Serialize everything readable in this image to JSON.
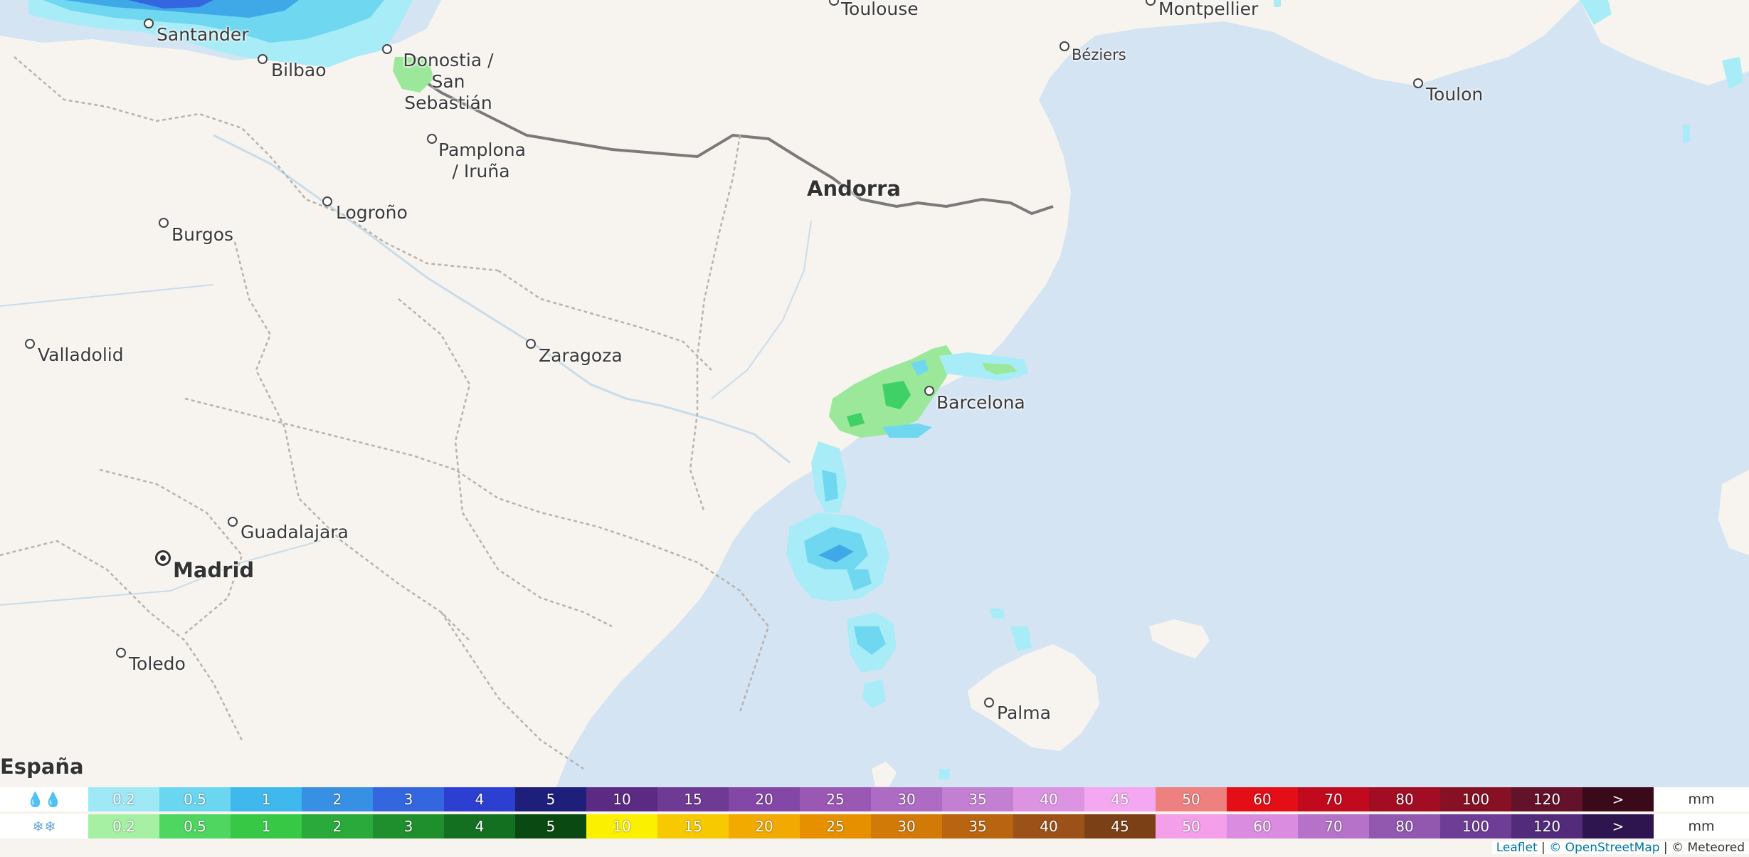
{
  "map": {
    "country_label": "España",
    "andorra_label": "Andorra",
    "cities": [
      {
        "key": "santander",
        "name": "Santander"
      },
      {
        "key": "bilbao",
        "name": "Bilbao"
      },
      {
        "key": "donostia",
        "name": "Donostia / San Sebastián"
      },
      {
        "key": "toulouse",
        "name": "Toulouse"
      },
      {
        "key": "montpellier",
        "name": "Montpellier"
      },
      {
        "key": "beziers",
        "name": "Béziers"
      },
      {
        "key": "toulon",
        "name": "Toulon"
      },
      {
        "key": "pamplona",
        "name": "Pamplona / Iruña"
      },
      {
        "key": "logrono",
        "name": "Logroño"
      },
      {
        "key": "burgos",
        "name": "Burgos"
      },
      {
        "key": "valladolid",
        "name": "Valladolid"
      },
      {
        "key": "zaragoza",
        "name": "Zaragoza"
      },
      {
        "key": "barcelona",
        "name": "Barcelona"
      },
      {
        "key": "guadalajara",
        "name": "Guadalajara"
      },
      {
        "key": "madrid",
        "name": "Madrid"
      },
      {
        "key": "toledo",
        "name": "Toledo"
      },
      {
        "key": "palma",
        "name": "Palma"
      }
    ],
    "colors": {
      "land": "#f7f4ef",
      "sea": "#d4e4f3",
      "precip_light": "#a8ecf7",
      "precip_cyan": "#6fd8f0",
      "precip_blue": "#3fa9e8",
      "snow_green": "#9be89a",
      "snow_green_dark": "#3fd165"
    }
  },
  "legend": {
    "rain_icon": "rain-drops-icon",
    "snow_icon": "snowflakes-icon",
    "unit": "mm",
    "rain": [
      {
        "label": "0.2",
        "color": "#9fe9f7"
      },
      {
        "label": "0.5",
        "color": "#6ad6f0"
      },
      {
        "label": "1",
        "color": "#3fb8ee"
      },
      {
        "label": "2",
        "color": "#3890e5"
      },
      {
        "label": "3",
        "color": "#3466e0"
      },
      {
        "label": "4",
        "color": "#2d3fd0"
      },
      {
        "label": "5",
        "color": "#1e1f7a"
      },
      {
        "label": "10",
        "color": "#5b2a82"
      },
      {
        "label": "15",
        "color": "#6f3a94"
      },
      {
        "label": "20",
        "color": "#8447a6"
      },
      {
        "label": "25",
        "color": "#9a58b4"
      },
      {
        "label": "30",
        "color": "#ad6bc4"
      },
      {
        "label": "35",
        "color": "#c37fd2"
      },
      {
        "label": "40",
        "color": "#dc94e2"
      },
      {
        "label": "45",
        "color": "#f4a8f1"
      },
      {
        "label": "50",
        "color": "#ef8080"
      },
      {
        "label": "60",
        "color": "#e30e16"
      },
      {
        "label": "70",
        "color": "#c20a1f"
      },
      {
        "label": "80",
        "color": "#a30d24"
      },
      {
        "label": "100",
        "color": "#861124"
      },
      {
        "label": "120",
        "color": "#63122a"
      },
      {
        "label": ">",
        "color": "#3b0a1a"
      }
    ],
    "snow": [
      {
        "label": "0.2",
        "color": "#a6f0a3"
      },
      {
        "label": "0.5",
        "color": "#4fd660"
      },
      {
        "label": "1",
        "color": "#37c846"
      },
      {
        "label": "2",
        "color": "#2aaa3a"
      },
      {
        "label": "3",
        "color": "#1f8f2e"
      },
      {
        "label": "4",
        "color": "#147021"
      },
      {
        "label": "5",
        "color": "#0a4a12"
      },
      {
        "label": "10",
        "color": "#fbf000"
      },
      {
        "label": "15",
        "color": "#f6c900"
      },
      {
        "label": "20",
        "color": "#f3aa00"
      },
      {
        "label": "25",
        "color": "#e69000"
      },
      {
        "label": "30",
        "color": "#d27a08"
      },
      {
        "label": "35",
        "color": "#b96410"
      },
      {
        "label": "40",
        "color": "#9c5118"
      },
      {
        "label": "45",
        "color": "#7b4016"
      },
      {
        "label": "50",
        "color": "#f59ee9"
      },
      {
        "label": "60",
        "color": "#d98ce0"
      },
      {
        "label": "70",
        "color": "#b672c8"
      },
      {
        "label": "80",
        "color": "#9258b0"
      },
      {
        "label": "100",
        "color": "#6e3d96"
      },
      {
        "label": "120",
        "color": "#522b7b"
      },
      {
        "label": ">",
        "color": "#2e1550"
      }
    ]
  },
  "attribution": {
    "leaflet": "Leaflet",
    "osm": "© OpenStreetMap",
    "meteored": "© Meteored",
    "sep": " | "
  }
}
